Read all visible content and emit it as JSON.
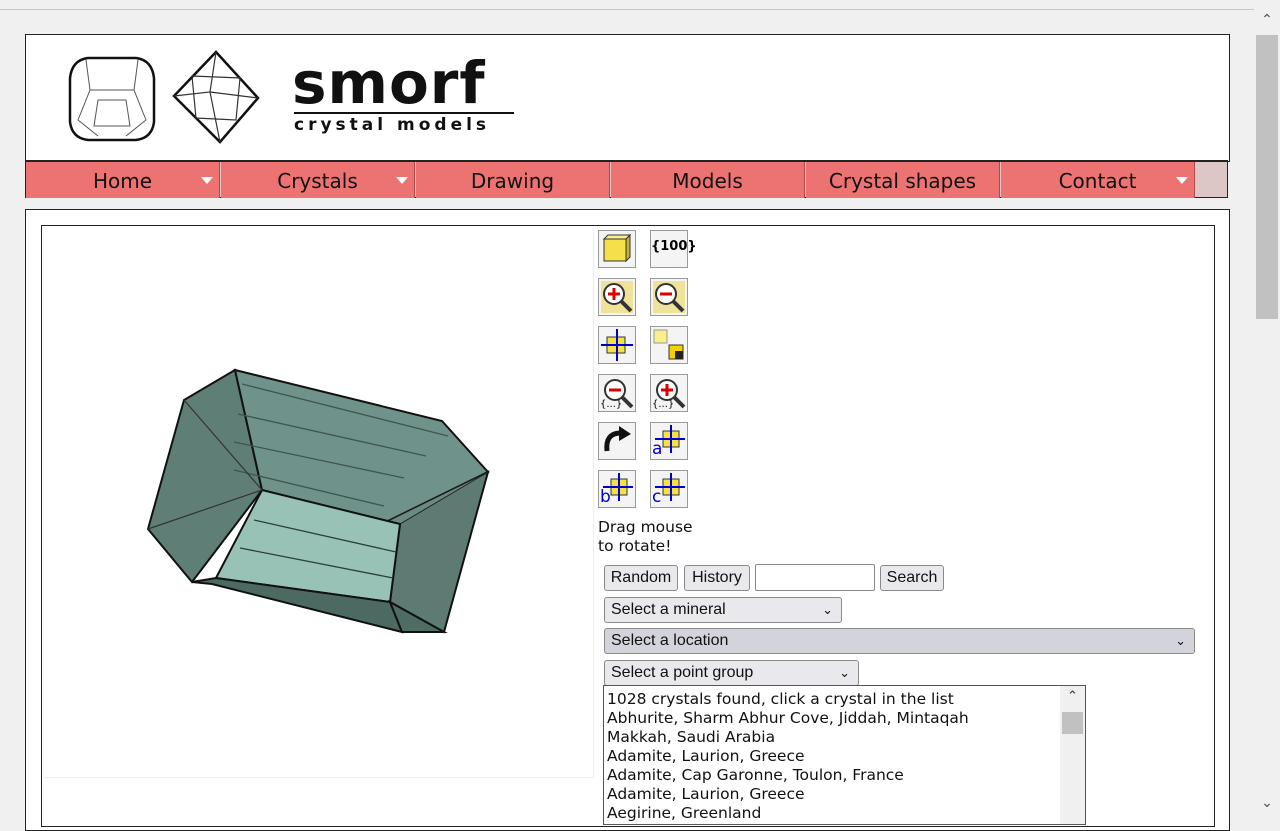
{
  "header": {
    "brand": "smorf",
    "tagline": "crystal models"
  },
  "nav": {
    "items": [
      {
        "label": "Home",
        "has_dropdown": true
      },
      {
        "label": "Crystals",
        "has_dropdown": true
      },
      {
        "label": "Drawing",
        "has_dropdown": false
      },
      {
        "label": "Models",
        "has_dropdown": false
      },
      {
        "label": "Crystal shapes",
        "has_dropdown": false
      },
      {
        "label": "Contact",
        "has_dropdown": true
      }
    ]
  },
  "toolbar": {
    "icons": [
      "unit-cell-icon",
      "miller-index-100-icon",
      "zoom-in-icon",
      "zoom-out-icon",
      "axes-icon",
      "face-color-icon",
      "zoom-in-alt-icon",
      "zoom-out-alt-icon",
      "rotate-icon",
      "axis-a-icon",
      "axis-b-icon",
      "axis-c-icon"
    ],
    "miller_label": "{100}",
    "axis_a": "a",
    "axis_b": "b",
    "axis_c": "c"
  },
  "viewer": {
    "hint_line1": "Drag mouse",
    "hint_line2": "to rotate!",
    "face_color": "#6b8c82",
    "highlight_face_color": "#98c2b6"
  },
  "controls": {
    "random_label": "Random",
    "history_label": "History",
    "search_value": "",
    "search_label": "Search",
    "mineral_select": "Select a mineral",
    "location_select": "Select a location",
    "pointgroup_select": "Select a point group"
  },
  "results": {
    "rows": [
      "1028 crystals found, click a crystal in the list",
      "Abhurite, Sharm Abhur Cove, Jiddah, Mintaqah",
      "Makkah, Saudi Arabia",
      "Adamite, Laurion, Greece",
      "Adamite, Cap Garonne, Toulon, France",
      "Adamite, Laurion, Greece",
      "Aegirine, Greenland"
    ]
  },
  "colors": {
    "nav_bg": "#ed7272",
    "accent_yellow": "#f4e04a",
    "axis_blue": "#0000cc"
  }
}
